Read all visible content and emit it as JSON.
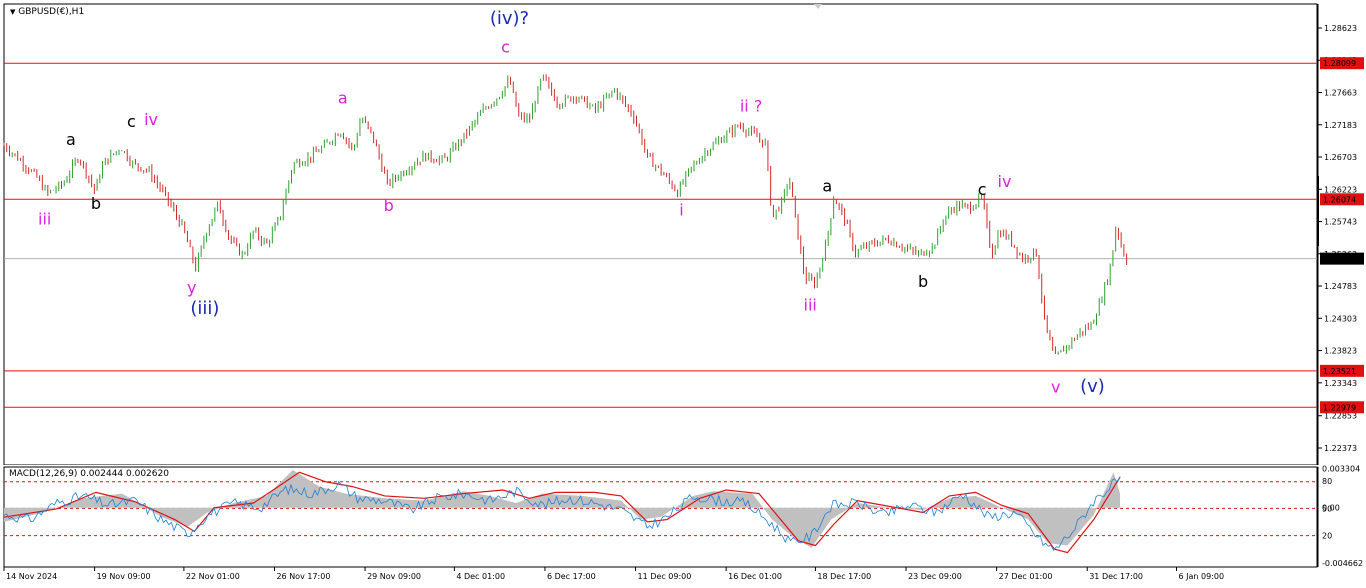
{
  "symbol_header": "GBPUSD(€),H1",
  "colors": {
    "bull": "#2ca02c",
    "bear": "#d62728",
    "level_line": "#e01010",
    "price_line": "#b0b0b0",
    "magenta": "#e020e0",
    "navy": "#1a2ab0",
    "black": "#000000",
    "macd_hist": "#c0c0c0",
    "macd_line": "#1e7fd8",
    "signal_line": "#e01010"
  },
  "chart_data": [
    {
      "type": "candlestick",
      "title": "GBPUSD(€),H1",
      "ylim": [
        1.2212,
        1.2898
      ],
      "y_ticks": [
        "1.28623",
        "1.28143",
        "1.27663",
        "1.27183",
        "1.26703",
        "1.26223",
        "1.25743",
        "1.25263",
        "1.24783",
        "1.24303",
        "1.23823",
        "1.23343",
        "1.22853",
        "1.22373"
      ],
      "x_labels": [
        "14 Nov 2024",
        "19 Nov 09:00",
        "22 Nov 01:00",
        "26 Nov 17:00",
        "29 Nov 09:00",
        "4 Dec 01:00",
        "6 Dec 17:00",
        "11 Dec 09:00",
        "16 Dec 01:00",
        "18 Dec 17:00",
        "23 Dec 09:00",
        "27 Dec 01:00",
        "31 Dec 17:00",
        "6 Jan 09:00"
      ],
      "x_label_positions": [
        0,
        0.069,
        0.137,
        0.206,
        0.275,
        0.343,
        0.412,
        0.481,
        0.55,
        0.618,
        0.687,
        0.756,
        0.825,
        0.893
      ],
      "price_path": [
        [
          0,
          1.2688
        ],
        [
          0.012,
          1.2666
        ],
        [
          0.025,
          1.264
        ],
        [
          0.033,
          1.2616
        ],
        [
          0.045,
          1.263
        ],
        [
          0.057,
          1.2672
        ],
        [
          0.069,
          1.262
        ],
        [
          0.076,
          1.2662
        ],
        [
          0.089,
          1.2685
        ],
        [
          0.098,
          1.266
        ],
        [
          0.11,
          1.265
        ],
        [
          0.123,
          1.2612
        ],
        [
          0.136,
          1.2566
        ],
        [
          0.146,
          1.2505
        ],
        [
          0.154,
          1.256
        ],
        [
          0.163,
          1.26
        ],
        [
          0.172,
          1.2548
        ],
        [
          0.182,
          1.2523
        ],
        [
          0.19,
          1.256
        ],
        [
          0.2,
          1.254
        ],
        [
          0.21,
          1.258
        ],
        [
          0.22,
          1.266
        ],
        [
          0.233,
          1.267
        ],
        [
          0.245,
          1.2688
        ],
        [
          0.256,
          1.271
        ],
        [
          0.266,
          1.268
        ],
        [
          0.272,
          1.273
        ],
        [
          0.281,
          1.27
        ],
        [
          0.292,
          1.263
        ],
        [
          0.305,
          1.265
        ],
        [
          0.32,
          1.2672
        ],
        [
          0.335,
          1.2665
        ],
        [
          0.35,
          1.27
        ],
        [
          0.365,
          1.274
        ],
        [
          0.377,
          1.2762
        ],
        [
          0.385,
          1.2785
        ],
        [
          0.392,
          1.273
        ],
        [
          0.4,
          1.2725
        ],
        [
          0.41,
          1.279
        ],
        [
          0.422,
          1.275
        ],
        [
          0.436,
          1.2762
        ],
        [
          0.45,
          1.274
        ],
        [
          0.465,
          1.277
        ],
        [
          0.48,
          1.273
        ],
        [
          0.49,
          1.267
        ],
        [
          0.5,
          1.265
        ],
        [
          0.513,
          1.2618
        ],
        [
          0.522,
          1.265
        ],
        [
          0.535,
          1.268
        ],
        [
          0.548,
          1.27
        ],
        [
          0.56,
          1.2718
        ],
        [
          0.572,
          1.2702
        ],
        [
          0.58,
          1.269
        ],
        [
          0.585,
          1.258
        ],
        [
          0.593,
          1.2605
        ],
        [
          0.598,
          1.264
        ],
        [
          0.605,
          1.255
        ],
        [
          0.61,
          1.249
        ],
        [
          0.618,
          1.2482
        ],
        [
          0.626,
          1.254
        ],
        [
          0.632,
          1.261
        ],
        [
          0.64,
          1.258
        ],
        [
          0.648,
          1.2528
        ],
        [
          0.66,
          1.254
        ],
        [
          0.673,
          1.2548
        ],
        [
          0.685,
          1.2536
        ],
        [
          0.697,
          1.2525
        ],
        [
          0.708,
          1.2538
        ],
        [
          0.716,
          1.258
        ],
        [
          0.725,
          1.2598
        ],
        [
          0.735,
          1.2595
        ],
        [
          0.745,
          1.261
        ],
        [
          0.752,
          1.2525
        ],
        [
          0.758,
          1.256
        ],
        [
          0.766,
          1.2548
        ],
        [
          0.776,
          1.2518
        ],
        [
          0.786,
          1.253
        ],
        [
          0.793,
          1.242
        ],
        [
          0.8,
          1.237
        ],
        [
          0.81,
          1.239
        ],
        [
          0.82,
          1.241
        ],
        [
          0.828,
          1.242
        ],
        [
          0.836,
          1.246
        ],
        [
          0.843,
          1.251
        ],
        [
          0.847,
          1.257
        ],
        [
          0.852,
          1.253
        ],
        [
          0.855,
          1.2519
        ]
      ],
      "levels": [
        {
          "value": 1.28099,
          "label": "1.28099"
        },
        {
          "value": 1.26074,
          "label": "1.26074"
        },
        {
          "value": 1.23521,
          "label": "1.23521"
        },
        {
          "value": 1.22979,
          "label": "1.22979"
        }
      ],
      "current_price": {
        "value": 1.25191,
        "label": "1.25191"
      },
      "annotations": [
        {
          "text": "(iv)?",
          "x": 0.385,
          "price": 1.2868,
          "color": "navy",
          "size": "big"
        },
        {
          "text": "c",
          "x": 0.382,
          "price": 1.2826,
          "color": "magenta",
          "size": "normal"
        },
        {
          "text": "a",
          "x": 0.258,
          "price": 1.275,
          "color": "magenta",
          "size": "normal"
        },
        {
          "text": "c",
          "x": 0.097,
          "price": 1.2715,
          "color": "black",
          "size": "normal"
        },
        {
          "text": "iv",
          "x": 0.112,
          "price": 1.2718,
          "color": "magenta",
          "size": "normal"
        },
        {
          "text": "a",
          "x": 0.051,
          "price": 1.2688,
          "color": "black",
          "size": "normal"
        },
        {
          "text": "b",
          "x": 0.07,
          "price": 1.2593,
          "color": "black",
          "size": "normal"
        },
        {
          "text": "iii",
          "x": 0.031,
          "price": 1.257,
          "color": "magenta",
          "size": "normal"
        },
        {
          "text": "b",
          "x": 0.293,
          "price": 1.259,
          "color": "magenta",
          "size": "normal"
        },
        {
          "text": "y",
          "x": 0.143,
          "price": 1.2468,
          "color": "magenta",
          "size": "normal"
        },
        {
          "text": "(iii)",
          "x": 0.153,
          "price": 1.2437,
          "color": "navy",
          "size": "big"
        },
        {
          "text": "ii ?",
          "x": 0.569,
          "price": 1.2738,
          "color": "magenta",
          "size": "normal"
        },
        {
          "text": "i",
          "x": 0.516,
          "price": 1.2583,
          "color": "magenta",
          "size": "normal"
        },
        {
          "text": "a",
          "x": 0.627,
          "price": 1.2619,
          "color": "black",
          "size": "normal"
        },
        {
          "text": "iii",
          "x": 0.614,
          "price": 1.2442,
          "color": "magenta",
          "size": "normal"
        },
        {
          "text": "c",
          "x": 0.745,
          "price": 1.2614,
          "color": "black",
          "size": "normal"
        },
        {
          "text": "iv",
          "x": 0.762,
          "price": 1.2626,
          "color": "magenta",
          "size": "normal"
        },
        {
          "text": "b",
          "x": 0.7,
          "price": 1.2477,
          "color": "black",
          "size": "normal"
        },
        {
          "text": "v",
          "x": 0.801,
          "price": 1.232,
          "color": "magenta",
          "size": "normal"
        },
        {
          "text": "(v)",
          "x": 0.829,
          "price": 1.2321,
          "color": "navy",
          "size": "big"
        }
      ]
    },
    {
      "type": "line",
      "title": "MACD(12,26,9) 0.002444 0.002620",
      "ylim": [
        -0.00502,
        0.00345
      ],
      "y_ticks": [
        {
          "label": "0.003304",
          "value": 0.003304
        },
        {
          "label": "80",
          "value": 0.00226
        },
        {
          "label": "0.00",
          "value": 0.0
        },
        {
          "label": "50",
          "value": -5e-05
        },
        {
          "label": "20",
          "value": -0.00236
        },
        {
          "label": "-0.004662",
          "value": -0.004662
        }
      ],
      "reference_levels": [
        0.0022,
        -5e-05,
        -0.00236
      ],
      "signal_path": [
        [
          0,
          -0.0008
        ],
        [
          0.04,
          -0.0001
        ],
        [
          0.07,
          0.0013
        ],
        [
          0.1,
          0.0005
        ],
        [
          0.13,
          -0.001
        ],
        [
          0.145,
          -0.002
        ],
        [
          0.16,
          0.0
        ],
        [
          0.19,
          0.0004
        ],
        [
          0.205,
          0.0015
        ],
        [
          0.225,
          0.003
        ],
        [
          0.245,
          0.0022
        ],
        [
          0.265,
          0.0018
        ],
        [
          0.29,
          0.001
        ],
        [
          0.32,
          0.0008
        ],
        [
          0.35,
          0.0012
        ],
        [
          0.38,
          0.0015
        ],
        [
          0.4,
          0.0008
        ],
        [
          0.42,
          0.0013
        ],
        [
          0.45,
          0.0013
        ],
        [
          0.47,
          0.001
        ],
        [
          0.49,
          -0.0012
        ],
        [
          0.505,
          -0.001
        ],
        [
          0.53,
          0.0008
        ],
        [
          0.55,
          0.0015
        ],
        [
          0.575,
          0.0012
        ],
        [
          0.59,
          -0.0008
        ],
        [
          0.605,
          -0.0028
        ],
        [
          0.618,
          -0.0032
        ],
        [
          0.632,
          -0.0014
        ],
        [
          0.65,
          0.0006
        ],
        [
          0.67,
          0.0002
        ],
        [
          0.7,
          -0.0004
        ],
        [
          0.72,
          0.001
        ],
        [
          0.74,
          0.0013
        ],
        [
          0.76,
          0.0002
        ],
        [
          0.78,
          -0.0005
        ],
        [
          0.8,
          -0.0035
        ],
        [
          0.81,
          -0.0038
        ],
        [
          0.83,
          -0.001
        ],
        [
          0.85,
          0.0026
        ]
      ],
      "hist_path": [
        [
          0,
          -0.0012
        ],
        [
          0.03,
          -0.0004
        ],
        [
          0.06,
          0.0008
        ],
        [
          0.09,
          0.0012
        ],
        [
          0.12,
          -0.0008
        ],
        [
          0.14,
          -0.0016
        ],
        [
          0.155,
          -0.0004
        ],
        [
          0.175,
          0.0004
        ],
        [
          0.2,
          0.001
        ],
        [
          0.22,
          0.0032
        ],
        [
          0.24,
          0.0018
        ],
        [
          0.26,
          0.0012
        ],
        [
          0.29,
          0.0008
        ],
        [
          0.32,
          0.0006
        ],
        [
          0.35,
          0.0014
        ],
        [
          0.37,
          0.001
        ],
        [
          0.39,
          0.0004
        ],
        [
          0.41,
          0.0012
        ],
        [
          0.44,
          0.001
        ],
        [
          0.47,
          0.0006
        ],
        [
          0.485,
          -0.001
        ],
        [
          0.5,
          -0.0008
        ],
        [
          0.525,
          0.001
        ],
        [
          0.54,
          0.0014
        ],
        [
          0.57,
          0.0012
        ],
        [
          0.585,
          -0.001
        ],
        [
          0.6,
          -0.0024
        ],
        [
          0.615,
          -0.0034
        ],
        [
          0.63,
          -0.001
        ],
        [
          0.65,
          0.0004
        ],
        [
          0.675,
          0.0
        ],
        [
          0.7,
          -0.0002
        ],
        [
          0.72,
          0.0008
        ],
        [
          0.74,
          0.001
        ],
        [
          0.76,
          0.0
        ],
        [
          0.78,
          -0.001
        ],
        [
          0.795,
          -0.003
        ],
        [
          0.81,
          -0.0032
        ],
        [
          0.83,
          -0.0006
        ],
        [
          0.845,
          0.003
        ],
        [
          0.85,
          0.0012
        ]
      ],
      "macd_path": [
        [
          0,
          -0.0006
        ],
        [
          0.02,
          -0.001
        ],
        [
          0.04,
          0.0004
        ],
        [
          0.06,
          0.001
        ],
        [
          0.08,
          0.0002
        ],
        [
          0.1,
          0.0006
        ],
        [
          0.12,
          -0.001
        ],
        [
          0.14,
          -0.0022
        ],
        [
          0.155,
          -0.0006
        ],
        [
          0.175,
          0.0004
        ],
        [
          0.195,
          0.0
        ],
        [
          0.215,
          0.0016
        ],
        [
          0.235,
          0.0012
        ],
        [
          0.255,
          0.002
        ],
        [
          0.27,
          0.0008
        ],
        [
          0.29,
          0.0006
        ],
        [
          0.31,
          -0.0002
        ],
        [
          0.33,
          0.0008
        ],
        [
          0.35,
          0.0012
        ],
        [
          0.37,
          0.0006
        ],
        [
          0.39,
          0.0014
        ],
        [
          0.41,
          0.0002
        ],
        [
          0.43,
          0.0008
        ],
        [
          0.45,
          0.0004
        ],
        [
          0.47,
          -0.0002
        ],
        [
          0.49,
          -0.0016
        ],
        [
          0.505,
          -0.0008
        ],
        [
          0.525,
          0.001
        ],
        [
          0.545,
          0.0006
        ],
        [
          0.565,
          0.0004
        ],
        [
          0.585,
          -0.0014
        ],
        [
          0.6,
          -0.003
        ],
        [
          0.615,
          -0.0024
        ],
        [
          0.63,
          0.0002
        ],
        [
          0.65,
          0.0004
        ],
        [
          0.67,
          -0.0006
        ],
        [
          0.69,
          0.0002
        ],
        [
          0.71,
          -0.0004
        ],
        [
          0.73,
          0.0012
        ],
        [
          0.75,
          -0.0008
        ],
        [
          0.77,
          -0.0004
        ],
        [
          0.79,
          -0.0028
        ],
        [
          0.8,
          -0.0036
        ],
        [
          0.815,
          -0.0018
        ],
        [
          0.83,
          0.0006
        ],
        [
          0.845,
          0.002
        ],
        [
          0.85,
          0.0024
        ]
      ]
    }
  ]
}
